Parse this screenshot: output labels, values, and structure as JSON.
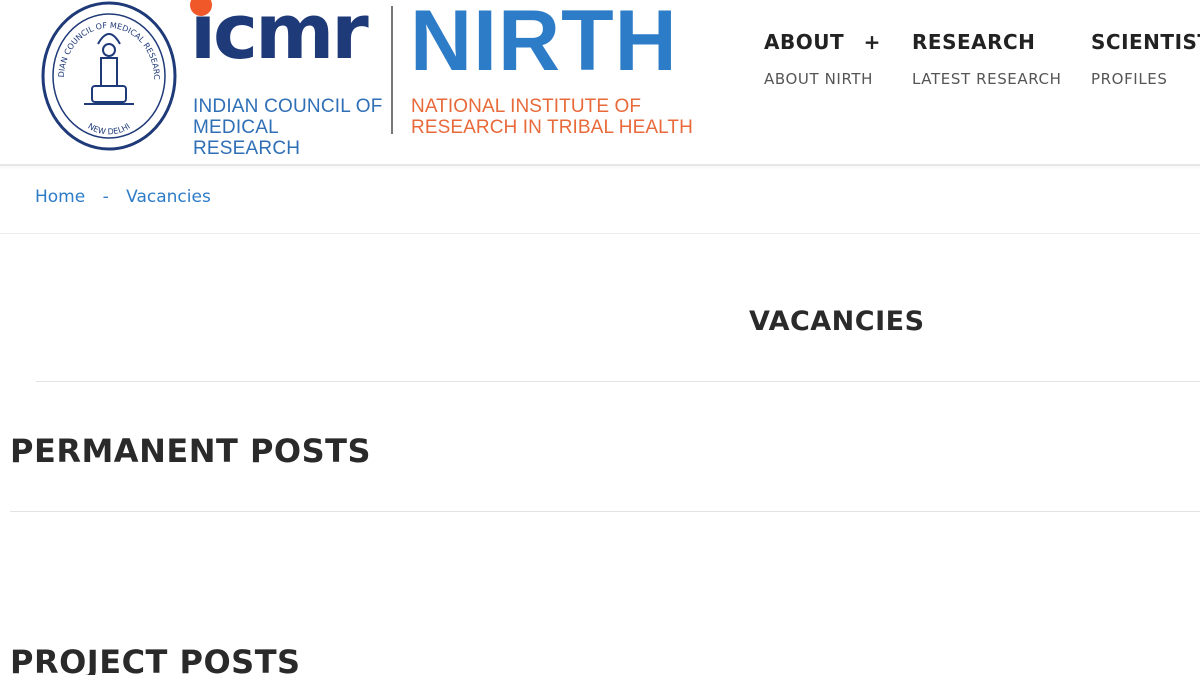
{
  "header": {
    "icmr_logo": {
      "wordmark": "icmr",
      "line1": "INDIAN COUNCIL OF",
      "line2": "MEDICAL RESEARCH"
    },
    "nirth_logo": {
      "wordmark": "NIRTH",
      "line1": "NATIONAL INSTITUTE OF",
      "line2": "RESEARCH IN TRIBAL HEALTH"
    },
    "emblem_text": {
      "top": "INDIAN COUNCIL OF MEDICAL RESEARCH",
      "bottom": "NEW DELHI"
    },
    "nav": [
      {
        "label": "ABOUT",
        "toggle": "+",
        "sub": "ABOUT NIRTH"
      },
      {
        "label": "RESEARCH",
        "sub": "LATEST RESEARCH"
      },
      {
        "label": "SCIENTIST",
        "sub": "PROFILES"
      }
    ]
  },
  "breadcrumb": {
    "home": "Home",
    "separator": "-",
    "current": "Vacancies"
  },
  "page": {
    "title": "VACANCIES",
    "sections": [
      "PERMANENT POSTS",
      "PROJECT POSTS"
    ]
  },
  "colors": {
    "icmr_blue": "#1f3a78",
    "nirth_blue": "#2d7cc7",
    "accent_orange": "#e86a3a",
    "link_blue": "#2d7cc7"
  }
}
